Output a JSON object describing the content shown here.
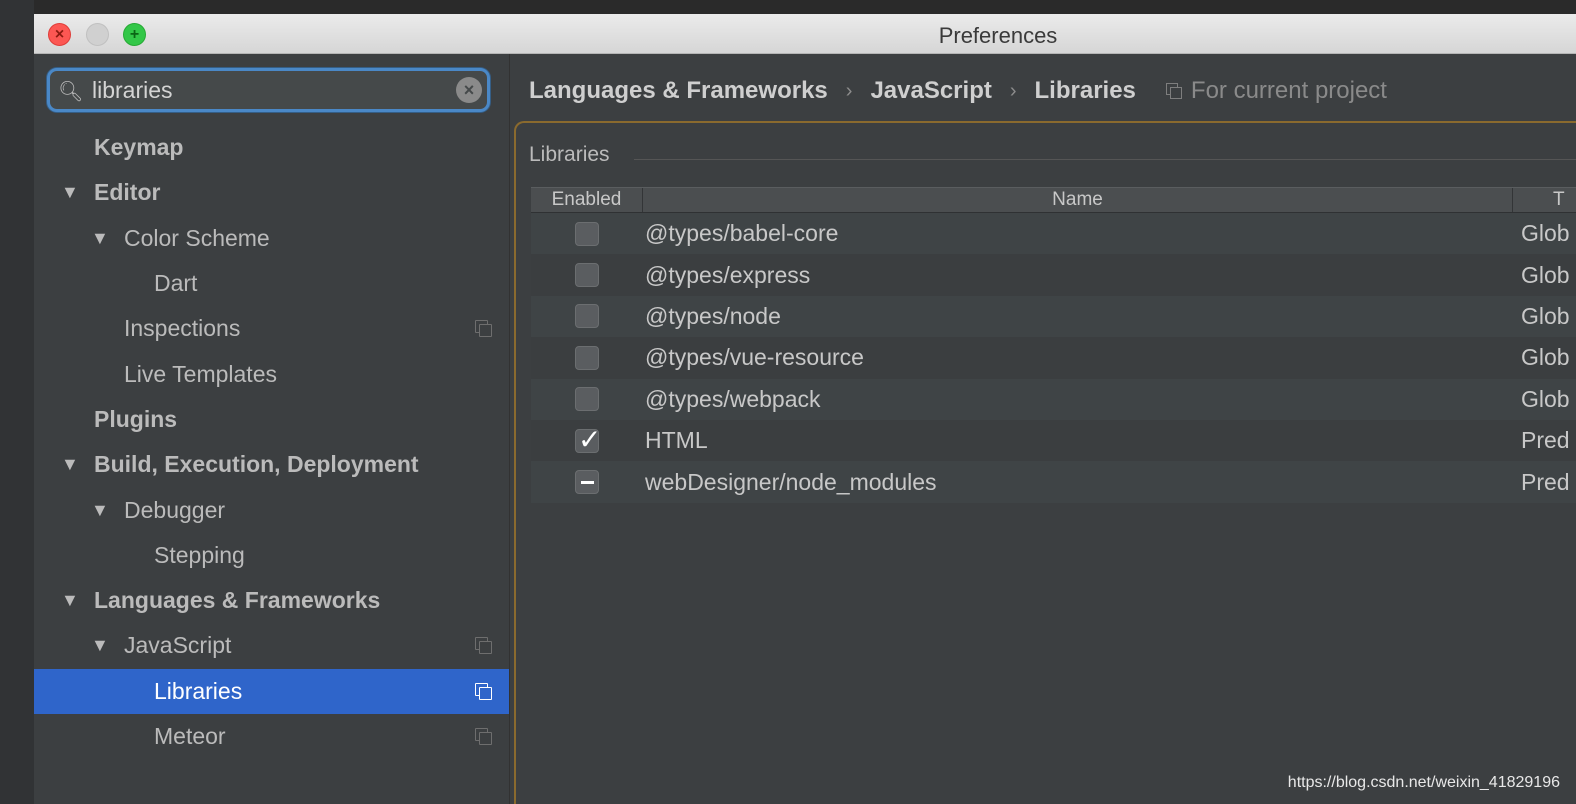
{
  "window": {
    "title": "Preferences"
  },
  "search": {
    "value": "libraries",
    "placeholder": ""
  },
  "tree": [
    {
      "label": "Keymap",
      "level": 0,
      "bold": true,
      "arrow": "",
      "copy": false,
      "selected": false
    },
    {
      "label": "Editor",
      "level": 0,
      "bold": true,
      "arrow": "▼",
      "copy": false,
      "selected": false
    },
    {
      "label": "Color Scheme",
      "level": 1,
      "bold": false,
      "arrow": "▼",
      "copy": false,
      "selected": false
    },
    {
      "label": "Dart",
      "level": 2,
      "bold": false,
      "arrow": "",
      "copy": false,
      "selected": false
    },
    {
      "label": "Inspections",
      "level": 1,
      "bold": false,
      "arrow": "",
      "copy": true,
      "selected": false
    },
    {
      "label": "Live Templates",
      "level": 1,
      "bold": false,
      "arrow": "",
      "copy": false,
      "selected": false
    },
    {
      "label": "Plugins",
      "level": 0,
      "bold": true,
      "arrow": "",
      "copy": false,
      "selected": false
    },
    {
      "label": "Build, Execution, Deployment",
      "level": 0,
      "bold": true,
      "arrow": "▼",
      "copy": false,
      "selected": false
    },
    {
      "label": "Debugger",
      "level": 1,
      "bold": false,
      "arrow": "▼",
      "copy": false,
      "selected": false
    },
    {
      "label": "Stepping",
      "level": 2,
      "bold": false,
      "arrow": "",
      "copy": false,
      "selected": false
    },
    {
      "label": "Languages & Frameworks",
      "level": 0,
      "bold": true,
      "arrow": "▼",
      "copy": false,
      "selected": false
    },
    {
      "label": "JavaScript",
      "level": 1,
      "bold": false,
      "arrow": "▼",
      "copy": true,
      "selected": false
    },
    {
      "label": "Libraries",
      "level": 2,
      "bold": false,
      "arrow": "",
      "copy": true,
      "selected": true
    },
    {
      "label": "Meteor",
      "level": 2,
      "bold": false,
      "arrow": "",
      "copy": true,
      "selected": false
    }
  ],
  "breadcrumb": {
    "items": [
      "Languages & Frameworks",
      "JavaScript",
      "Libraries"
    ],
    "separator": "›",
    "scope_label": "For current project"
  },
  "libraries": {
    "group_title": "Libraries",
    "columns": {
      "enabled": "Enabled",
      "name": "Name",
      "type": "T"
    },
    "rows": [
      {
        "enabled": "unchecked",
        "name": "@types/babel-core",
        "type": "Glob"
      },
      {
        "enabled": "unchecked",
        "name": "@types/express",
        "type": "Glob"
      },
      {
        "enabled": "unchecked",
        "name": "@types/node",
        "type": "Glob"
      },
      {
        "enabled": "unchecked",
        "name": "@types/vue-resource",
        "type": "Glob"
      },
      {
        "enabled": "unchecked",
        "name": "@types/webpack",
        "type": "Glob"
      },
      {
        "enabled": "checked",
        "name": "HTML",
        "type": "Pred"
      },
      {
        "enabled": "partial",
        "name": "webDesigner/node_modules",
        "type": "Pred"
      }
    ]
  },
  "watermark": "https://blog.csdn.net/weixin_41829196",
  "colors": {
    "selection": "#2f65ca",
    "search_focus": "#4a88c7",
    "background": "#3c3f41",
    "close": "#fc5753",
    "maximize": "#33c748"
  }
}
